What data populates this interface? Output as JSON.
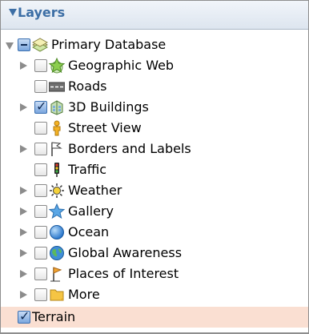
{
  "panel": {
    "title": "Layers"
  },
  "layers": [
    {
      "label": "Primary Database",
      "icon": "database-icon",
      "checkbox": "mixed",
      "expander": "expanded"
    },
    {
      "label": "Geographic Web",
      "icon": "star-globe-icon",
      "checkbox": "unchecked",
      "expander": "collapsed"
    },
    {
      "label": "Roads",
      "icon": "roads-icon",
      "checkbox": "unchecked",
      "expander": "none"
    },
    {
      "label": "3D Buildings",
      "icon": "buildings-icon",
      "checkbox": "checked",
      "expander": "collapsed"
    },
    {
      "label": "Street View",
      "icon": "pegman-icon",
      "checkbox": "unchecked",
      "expander": "none"
    },
    {
      "label": "Borders and Labels",
      "icon": "flag-icon",
      "checkbox": "unchecked",
      "expander": "collapsed"
    },
    {
      "label": "Traffic",
      "icon": "traffic-light-icon",
      "checkbox": "unchecked",
      "expander": "none"
    },
    {
      "label": "Weather",
      "icon": "sun-icon",
      "checkbox": "unchecked",
      "expander": "collapsed"
    },
    {
      "label": "Gallery",
      "icon": "gallery-star-icon",
      "checkbox": "unchecked",
      "expander": "collapsed"
    },
    {
      "label": "Ocean",
      "icon": "ocean-icon",
      "checkbox": "unchecked",
      "expander": "collapsed"
    },
    {
      "label": "Global Awareness",
      "icon": "globe-icon",
      "checkbox": "unchecked",
      "expander": "collapsed"
    },
    {
      "label": "Places of Interest",
      "icon": "pin-flag-icon",
      "checkbox": "unchecked",
      "expander": "collapsed"
    },
    {
      "label": "More",
      "icon": "folder-icon",
      "checkbox": "unchecked",
      "expander": "collapsed"
    },
    {
      "label": "Terrain",
      "icon": "",
      "checkbox": "checked",
      "expander": "none",
      "selected": true
    }
  ]
}
